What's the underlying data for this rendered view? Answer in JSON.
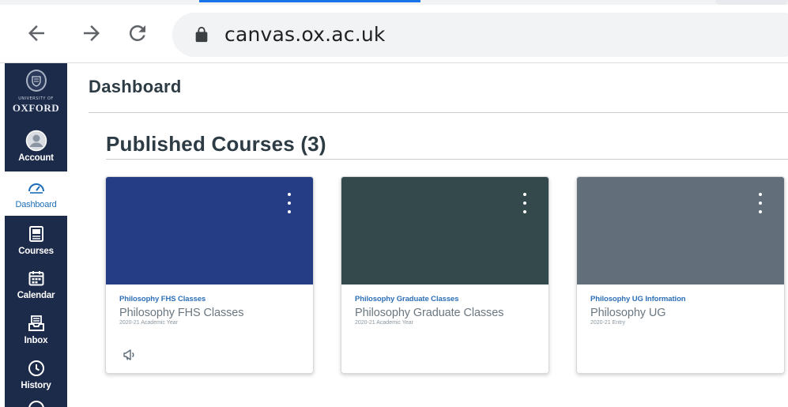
{
  "browser": {
    "url": "canvas.ox.ac.uk",
    "icons": [
      "arrow-back-icon",
      "arrow-forward-icon",
      "reload-icon",
      "lock-icon"
    ]
  },
  "global_nav": {
    "logo": {
      "line1": "UNIVERSITY OF",
      "line2": "OXFORD"
    },
    "items": [
      {
        "label": "Account",
        "icon": "account-icon",
        "active": false
      },
      {
        "label": "Dashboard",
        "icon": "dashboard-icon",
        "active": true
      },
      {
        "label": "Courses",
        "icon": "courses-icon",
        "active": false
      },
      {
        "label": "Calendar",
        "icon": "calendar-icon",
        "active": false
      },
      {
        "label": "Inbox",
        "icon": "inbox-icon",
        "active": false
      },
      {
        "label": "History",
        "icon": "history-icon",
        "active": false
      }
    ],
    "background": "#1c2b4a",
    "active_color": "#1c6eb8"
  },
  "main": {
    "breadcrumb": "Dashboard",
    "section_title": "Published Courses (3)",
    "cards": [
      {
        "short_name": "Philosophy FHS Classes",
        "name": "Philosophy FHS Classes",
        "term": "2020-21 Academic Year",
        "color": "#253d84",
        "action_icon": "announcement-icon"
      },
      {
        "short_name": "Philosophy Graduate Classes",
        "name": "Philosophy Graduate Classes",
        "term": "2020-21 Academic Year",
        "color": "#34494b",
        "action_icon": ""
      },
      {
        "short_name": "Philosophy UG Information",
        "name": "Philosophy UG",
        "term": "2020-21 Entry",
        "color": "#636e7b",
        "action_icon": ""
      }
    ]
  }
}
